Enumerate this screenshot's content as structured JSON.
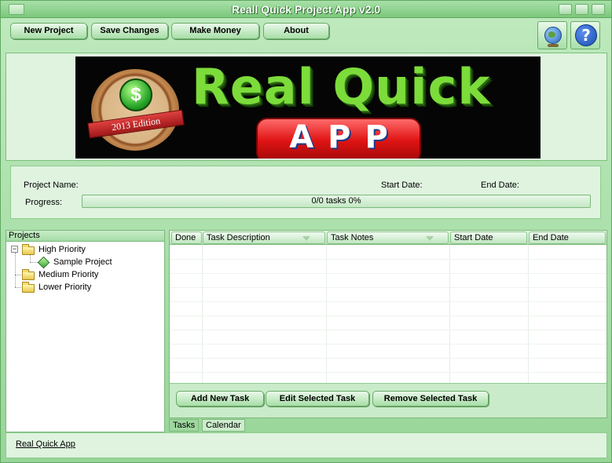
{
  "window": {
    "title": "Reall Quick Project App v2.0"
  },
  "toolbar": {
    "new_project": "New Project",
    "save_changes": "Save Changes",
    "make_money": "Make Money",
    "about": "About",
    "icons": [
      "globe-icon",
      "help-icon"
    ]
  },
  "banner": {
    "title_top": "Real Quick",
    "title_bottom": "APP",
    "edition": "2013 Edition",
    "coin_symbol": "$"
  },
  "info": {
    "project_name_label": "Project Name:",
    "project_name_value": "",
    "start_date_label": "Start Date:",
    "start_date_value": "",
    "end_date_label": "End Date:",
    "end_date_value": "",
    "progress_label": "Progress:",
    "progress_text": "0/0 tasks  0%",
    "progress_fraction": 0
  },
  "projects": {
    "header": "Projects",
    "items": [
      {
        "label": "High Priority",
        "expanded": true,
        "children": [
          {
            "label": "Sample Project"
          }
        ]
      },
      {
        "label": "Medium Priority"
      },
      {
        "label": "Lower Priority"
      }
    ]
  },
  "tasks": {
    "columns": [
      "Done",
      "Task Description",
      "Task Notes",
      "Start Date",
      "End Date"
    ],
    "rows": [],
    "add": "Add New Task",
    "edit": "Edit Selected Task",
    "remove": "Remove Selected Task"
  },
  "tabs": [
    "Tasks",
    "Calendar"
  ],
  "active_tab": "Tasks",
  "status": {
    "link": "Real Quick App"
  },
  "colors": {
    "accent": "#9fd89f",
    "title_text": "#ffffff",
    "banner_green": "#7cdc3a",
    "banner_red": "#e01414"
  }
}
